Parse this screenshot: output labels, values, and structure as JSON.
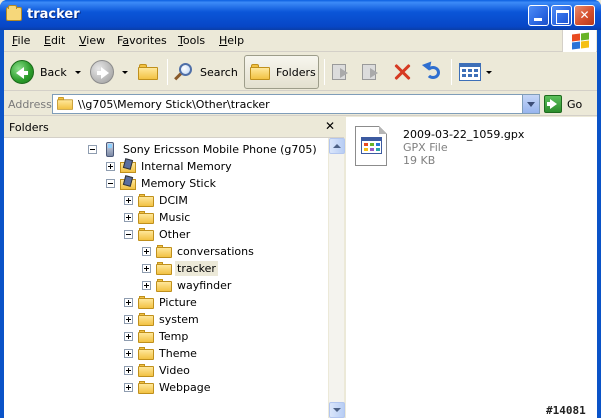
{
  "window": {
    "title": "tracker"
  },
  "menu": [
    {
      "label": "File",
      "ul": "F",
      "rest": "ile"
    },
    {
      "label": "Edit",
      "ul": "E",
      "rest": "dit"
    },
    {
      "label": "View",
      "ul": "V",
      "rest": "iew"
    },
    {
      "label": "Favorites",
      "ul": "F",
      "rest": "avorites",
      "pre": "F",
      "mid": "a"
    },
    {
      "label": "Tools",
      "ul": "T",
      "rest": "ools"
    },
    {
      "label": "Help",
      "ul": "H",
      "rest": "elp"
    }
  ],
  "toolbar": {
    "back_label": "Back",
    "search_label": "Search",
    "folders_label": "Folders"
  },
  "address": {
    "label": "Address",
    "value": "\\\\g705\\Memory Stick\\Other\\tracker",
    "go_label": "Go"
  },
  "folders_pane": {
    "title": "Folders",
    "close_glyph": "✕",
    "tree": [
      {
        "label": "Sony Ericsson Mobile Phone (g705)",
        "icon": "phone-icon",
        "expander": "minus"
      },
      {
        "label": "Internal Memory",
        "icon": "memory-icon",
        "expander": "plus"
      },
      {
        "label": "Memory Stick",
        "icon": "memory-stick-icon",
        "expander": "minus"
      },
      {
        "label": "DCIM",
        "icon": "folder-icon",
        "expander": "plus"
      },
      {
        "label": "Music",
        "icon": "folder-icon",
        "expander": "plus"
      },
      {
        "label": "Other",
        "icon": "folder-icon",
        "expander": "minus"
      },
      {
        "label": "conversations",
        "icon": "folder-icon",
        "expander": "plus"
      },
      {
        "label": "tracker",
        "icon": "folder-icon",
        "expander": "plus",
        "selected": true
      },
      {
        "label": "wayfinder",
        "icon": "folder-icon",
        "expander": "plus"
      },
      {
        "label": "Picture",
        "icon": "folder-icon",
        "expander": "plus"
      },
      {
        "label": "system",
        "icon": "folder-icon",
        "expander": "plus"
      },
      {
        "label": "Temp",
        "icon": "folder-icon",
        "expander": "plus"
      },
      {
        "label": "Theme",
        "icon": "folder-icon",
        "expander": "plus"
      },
      {
        "label": "Video",
        "icon": "folder-icon",
        "expander": "plus"
      },
      {
        "label": "Webpage",
        "icon": "folder-icon",
        "expander": "plus"
      }
    ]
  },
  "files": [
    {
      "name": "2009-03-22_1059.gpx",
      "type": "GPX File",
      "size": "19 KB",
      "icon": "gpx-file-icon"
    }
  ],
  "watermark": "#14081",
  "colors": {
    "titlebar": "#0a53c8",
    "chrome": "#ece9d8",
    "close_button": "#d6502e"
  }
}
